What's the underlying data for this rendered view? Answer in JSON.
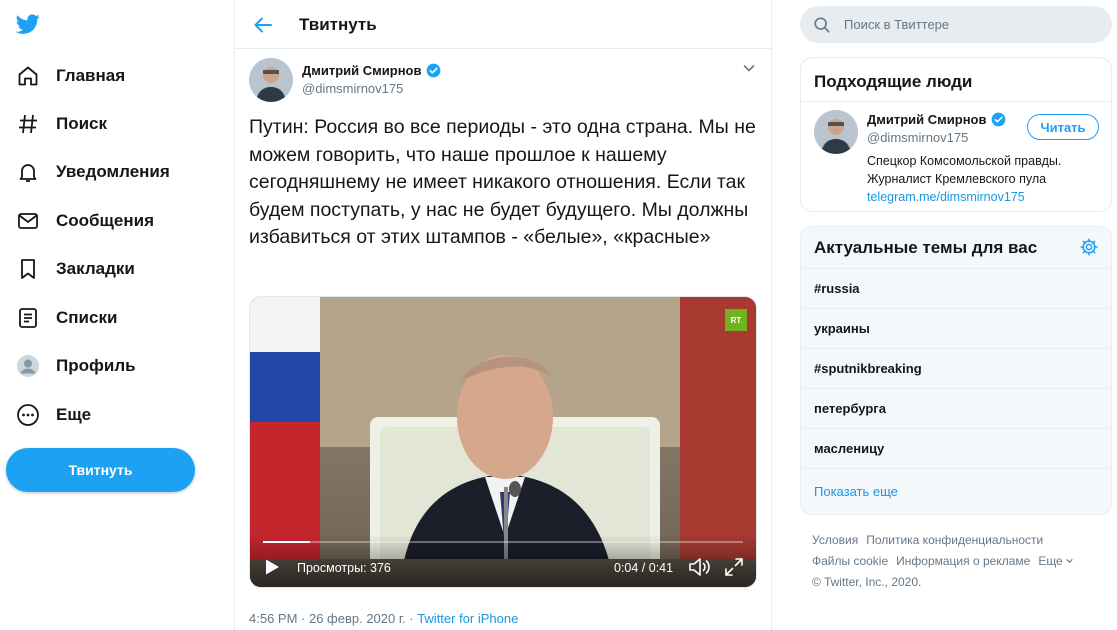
{
  "nav": {
    "logo": "twitter-bird-icon",
    "items": [
      {
        "label": "Главная",
        "icon": "home-icon"
      },
      {
        "label": "Поиск",
        "icon": "hashtag-icon"
      },
      {
        "label": "Уведомления",
        "icon": "bell-icon"
      },
      {
        "label": "Сообщения",
        "icon": "mail-icon"
      },
      {
        "label": "Закладки",
        "icon": "bookmark-icon"
      },
      {
        "label": "Списки",
        "icon": "list-icon"
      },
      {
        "label": "Профиль",
        "icon": "profile-icon"
      },
      {
        "label": "Еще",
        "icon": "more-icon"
      }
    ],
    "tweet_button": "Твитнуть"
  },
  "main": {
    "title": "Твитнуть",
    "tweet": {
      "author_name": "Дмитрий Смирнов",
      "author_handle": "@dimsmirnov175",
      "text": "Путин: Россия во все периоды - это одна страна. Мы не можем говорить, что наше прошлое к нашему сегодняшнему не имеет никакого отношения. Если так будем поступать, у нас не будет будущего. Мы должны избавиться от этих штампов - «белые», «красные»",
      "video": {
        "badge": "RT",
        "views": "Просмотры: 376",
        "time": "0:04 / 0:41",
        "progress": 0.098
      },
      "timestamp": "4:56 PM · 26 февр. 2020 г. · ",
      "source": "Twitter for iPhone"
    }
  },
  "search": {
    "placeholder": "Поиск в Твиттере"
  },
  "who_to_follow": {
    "title": "Подходящие люди",
    "name": "Дмитрий Смирнов",
    "handle": "@dimsmirnov175",
    "follow_label": "Читать",
    "bio": "Спецкор Комсомольской правды. Журналист Кремлевского пула",
    "bio_link": "telegram.me/dimsmirnov175"
  },
  "trends": {
    "title": "Актуальные темы для вас",
    "items": [
      "#russia",
      "украины",
      "#sputnikbreaking",
      "петербурга",
      "масленицу"
    ],
    "show_more": "Показать еще"
  },
  "footer": {
    "links": [
      "Условия",
      "Политика конфиденциальности",
      "Файлы cookie",
      "Информация о рекламе",
      "Еще"
    ],
    "copyright": "© Twitter, Inc., 2020."
  },
  "colors": {
    "accent": "#1da1f2",
    "link": "#1b95e0",
    "text": "#14171a",
    "muted": "#657786",
    "rt_green": "#6fb41e"
  }
}
